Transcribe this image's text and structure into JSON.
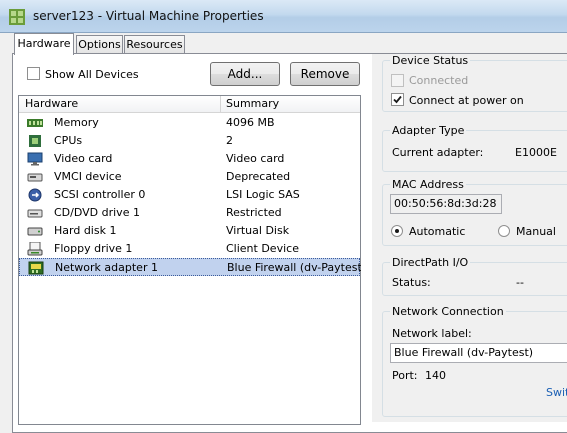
{
  "window": {
    "title": "server123 - Virtual Machine Properties"
  },
  "tabs": [
    {
      "label": "Hardware",
      "active": true
    },
    {
      "label": "Options",
      "active": false
    },
    {
      "label": "Resources",
      "active": false
    }
  ],
  "left": {
    "show_all_devices_label": "Show All Devices",
    "show_all_devices_checked": false,
    "add_label": "Add...",
    "remove_label": "Remove",
    "columns": [
      "Hardware",
      "Summary"
    ],
    "rows": [
      {
        "icon": "memory-icon",
        "name": "Memory",
        "summary": "4096 MB",
        "selected": false
      },
      {
        "icon": "cpu-icon",
        "name": "CPUs",
        "summary": "2",
        "selected": false
      },
      {
        "icon": "monitor-icon",
        "name": "Video card",
        "summary": "Video card",
        "selected": false
      },
      {
        "icon": "device-icon",
        "name": "VMCI device",
        "summary": "Deprecated",
        "selected": false
      },
      {
        "icon": "scsi-icon",
        "name": "SCSI controller 0",
        "summary": "LSI Logic SAS",
        "selected": false
      },
      {
        "icon": "cd-drive-icon",
        "name": "CD/DVD drive 1",
        "summary": "Restricted",
        "selected": false
      },
      {
        "icon": "hard-disk-icon",
        "name": "Hard disk 1",
        "summary": "Virtual Disk",
        "selected": false
      },
      {
        "icon": "floppy-icon",
        "name": "Floppy drive 1",
        "summary": "Client Device",
        "selected": false
      },
      {
        "icon": "network-adapter-icon",
        "name": "Network adapter 1",
        "summary": "Blue Firewall (dv-Paytest)",
        "selected": true
      }
    ]
  },
  "device_status": {
    "title": "Device Status",
    "connected_label": "Connected",
    "connected_checked": false,
    "connect_at_power_on_label": "Connect at power on",
    "connect_at_power_on_checked": true
  },
  "adapter_type": {
    "title": "Adapter Type",
    "current_label": "Current adapter:",
    "current_value": "E1000E"
  },
  "mac_address": {
    "title": "MAC Address",
    "value": "00:50:56:8d:3d:28",
    "automatic_label": "Automatic",
    "manual_label": "Manual",
    "selected": "Automatic"
  },
  "directpath": {
    "title": "DirectPath I/O",
    "status_label": "Status:",
    "status_value": "--"
  },
  "network_connection": {
    "title": "Network Connection",
    "network_label_caption": "Network label:",
    "network_label_value": "Blue Firewall (dv-Paytest)",
    "port_label": "Port:",
    "port_value": "140",
    "switch_link": "Swit"
  }
}
